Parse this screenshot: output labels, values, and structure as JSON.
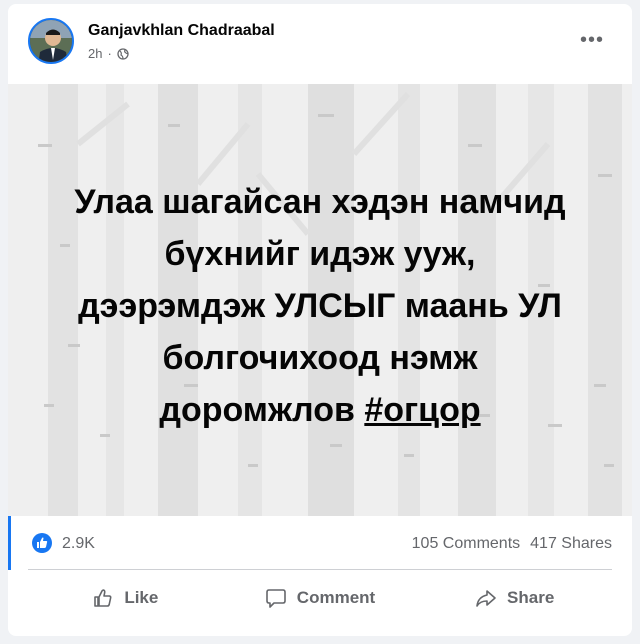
{
  "post": {
    "author": "Ganjavkhlan Chadraabal",
    "time": "2h",
    "privacy_icon": "globe-icon",
    "text_lines": [
      "Улаа шагайсан хэдэн намчид",
      "бүхнийг идэж ууж,",
      "дээрэмдэж УЛСЫГ маань УЛ",
      "болгочихоод нэмж",
      "доромжлов"
    ],
    "hashtag": "#огцор"
  },
  "stats": {
    "reactions": "2.9K",
    "comments": "105 Comments",
    "shares": "417 Shares"
  },
  "actions": {
    "like": "Like",
    "comment": "Comment",
    "share": "Share"
  },
  "colors": {
    "accent": "#1877f2",
    "secondary_text": "#65676b"
  }
}
